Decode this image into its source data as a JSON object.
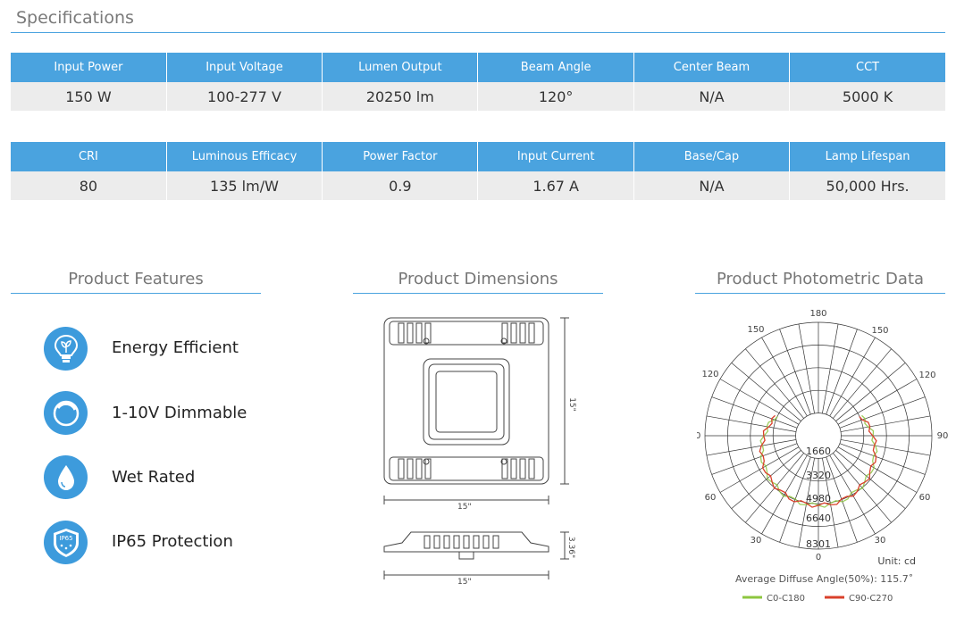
{
  "title": "Specifications",
  "spec_table_1": {
    "headers": [
      "Input Power",
      "Input Voltage",
      "Lumen Output",
      "Beam Angle",
      "Center Beam",
      "CCT"
    ],
    "values": [
      "150 W",
      "100-277 V",
      "20250 lm",
      "120°",
      "N/A",
      "5000 K"
    ]
  },
  "spec_table_2": {
    "headers": [
      "CRI",
      "Luminous Efficacy",
      "Power Factor",
      "Input Current",
      "Base/Cap",
      "Lamp Lifespan"
    ],
    "values": [
      "80",
      "135 lm/W",
      "0.9",
      "1.67 A",
      "N/A",
      "50,000 Hrs."
    ]
  },
  "features": {
    "heading": "Product Features",
    "items": [
      {
        "label": "Energy Efficient",
        "icon": "bulb-leaf-icon"
      },
      {
        "label": "1-10V Dimmable",
        "icon": "dimmer-icon"
      },
      {
        "label": "Wet Rated",
        "icon": "water-drop-icon"
      },
      {
        "label": "IP65 Protection",
        "icon": "ip65-shield-icon"
      }
    ],
    "ip65_badge_text": "IP65"
  },
  "dimensions": {
    "heading": "Product Dimensions",
    "top_width": "15\"",
    "top_height": "15\"",
    "side_width": "15\"",
    "side_height": "3.36\""
  },
  "photometric": {
    "heading": "Product Photometric Data",
    "angle_labels": {
      "top": "180",
      "upper_left": "150",
      "upper_right": "150",
      "mid_upper_left": "120",
      "mid_upper_right": "120",
      "left": "90",
      "right": "90",
      "lower_left": "60",
      "lower_right": "60",
      "bottom_left": "30",
      "bottom_right": "30",
      "bottom": "0"
    },
    "radial_values": [
      "1660",
      "3320",
      "4980",
      "6640",
      "8301"
    ],
    "unit": "Unit: cd",
    "average_angle": "Average Diffuse Angle(50%): 115.7˚",
    "legend": [
      {
        "name": "C0-C180",
        "color": "#8dc63f"
      },
      {
        "name": "C90-C270",
        "color": "#d9402b"
      }
    ]
  }
}
